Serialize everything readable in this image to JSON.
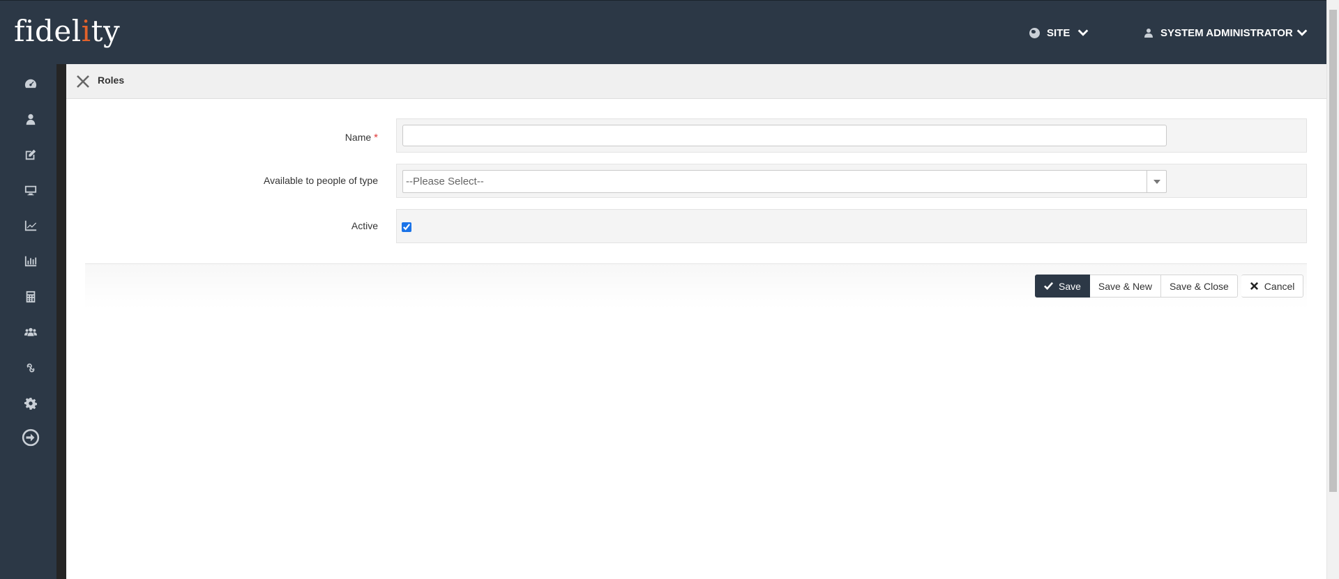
{
  "app": {
    "logo_text_pre": "fidel",
    "logo_text_accent": "i",
    "logo_text_post": "ty"
  },
  "header": {
    "site_label": "SITE",
    "user_label": "SYSTEM ADMINISTRATOR"
  },
  "sidebar": {
    "items": [
      {
        "icon": "dashboard-icon"
      },
      {
        "icon": "user-icon"
      },
      {
        "icon": "edit-icon"
      },
      {
        "icon": "monitor-icon"
      },
      {
        "icon": "line-chart-icon"
      },
      {
        "icon": "bar-chart-icon"
      },
      {
        "icon": "calculator-icon"
      },
      {
        "icon": "users-icon"
      },
      {
        "icon": "link-icon"
      },
      {
        "icon": "gear-icon"
      },
      {
        "icon": "sign-out-icon"
      }
    ]
  },
  "page": {
    "title": "Roles"
  },
  "form": {
    "name_label": "Name",
    "name_required_mark": "*",
    "name_value": "",
    "type_label": "Available to people of type",
    "type_selected": "--Please Select--",
    "active_label": "Active",
    "active_checked": true
  },
  "actions": {
    "save": "Save",
    "save_new": "Save & New",
    "save_close": "Save & Close",
    "cancel": "Cancel"
  },
  "colors": {
    "header_bg": "#2c3846",
    "logo_accent": "#e2622b",
    "required": "#e03b3b"
  }
}
